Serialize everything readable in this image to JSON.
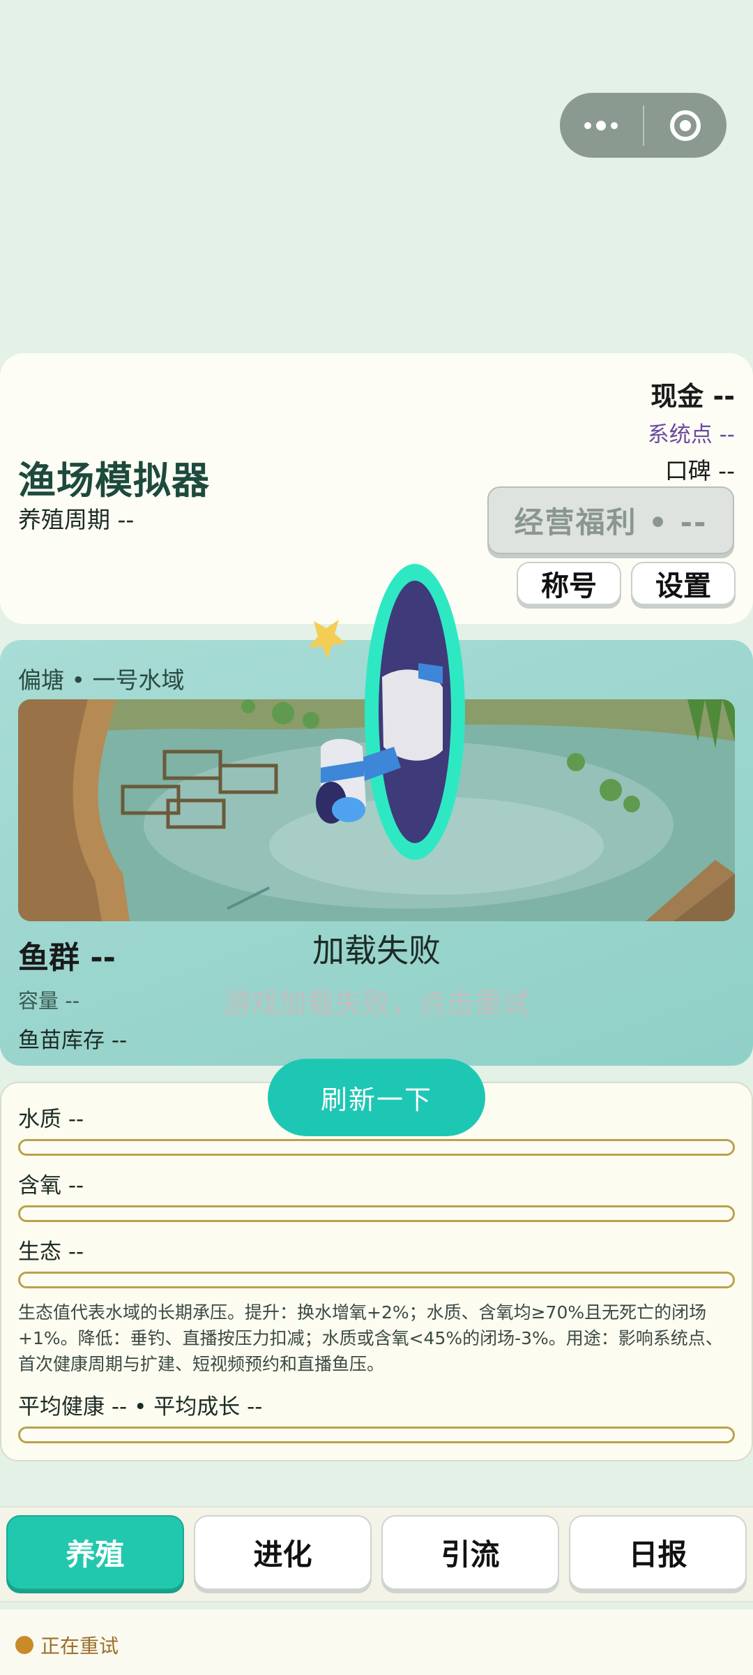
{
  "capsule": {
    "more_icon": "more-dots-icon",
    "close_icon": "target-close-icon"
  },
  "header": {
    "title": "渔场模拟器",
    "cycle": "养殖周期  --",
    "cash": "现金  --",
    "system_points": "系统点  --",
    "reputation": "口碑  --",
    "welfare_button": "经营福利  •  --",
    "title_button": "称号",
    "settings_button": "设置"
  },
  "pond": {
    "location": "偏塘  •  一号水域",
    "fish_group": "鱼群  --",
    "capacity": "容量  --",
    "fry_stock": "鱼苗库存  --",
    "load_fail_title": "加载失败",
    "load_fail_message": "游戏加载失败，点击重试"
  },
  "refresh_button": "刷新一下",
  "metrics": {
    "water_quality": "水质 --",
    "oxygen": "含氧 --",
    "ecology": "生态 --",
    "ecology_description": "生态值代表水域的长期承压。提升：换水增氧+2%；水质、含氧均≥70%且无死亡的闭场+1%。降低：垂钓、直播按压力扣减；水质或含氧<45%的闭场-3%。用途：影响系统点、首次健康周期与扩建、短视频预约和直播鱼压。",
    "averages": "平均健康 --  •  平均成长 --",
    "bar_levels": [
      0,
      0,
      0,
      0
    ]
  },
  "tabs": [
    {
      "label": "养殖",
      "active": true
    },
    {
      "label": "进化",
      "active": false
    },
    {
      "label": "引流",
      "active": false
    },
    {
      "label": "日报",
      "active": false
    }
  ],
  "status": {
    "text": "正在重试",
    "color": "#c98a2a"
  }
}
